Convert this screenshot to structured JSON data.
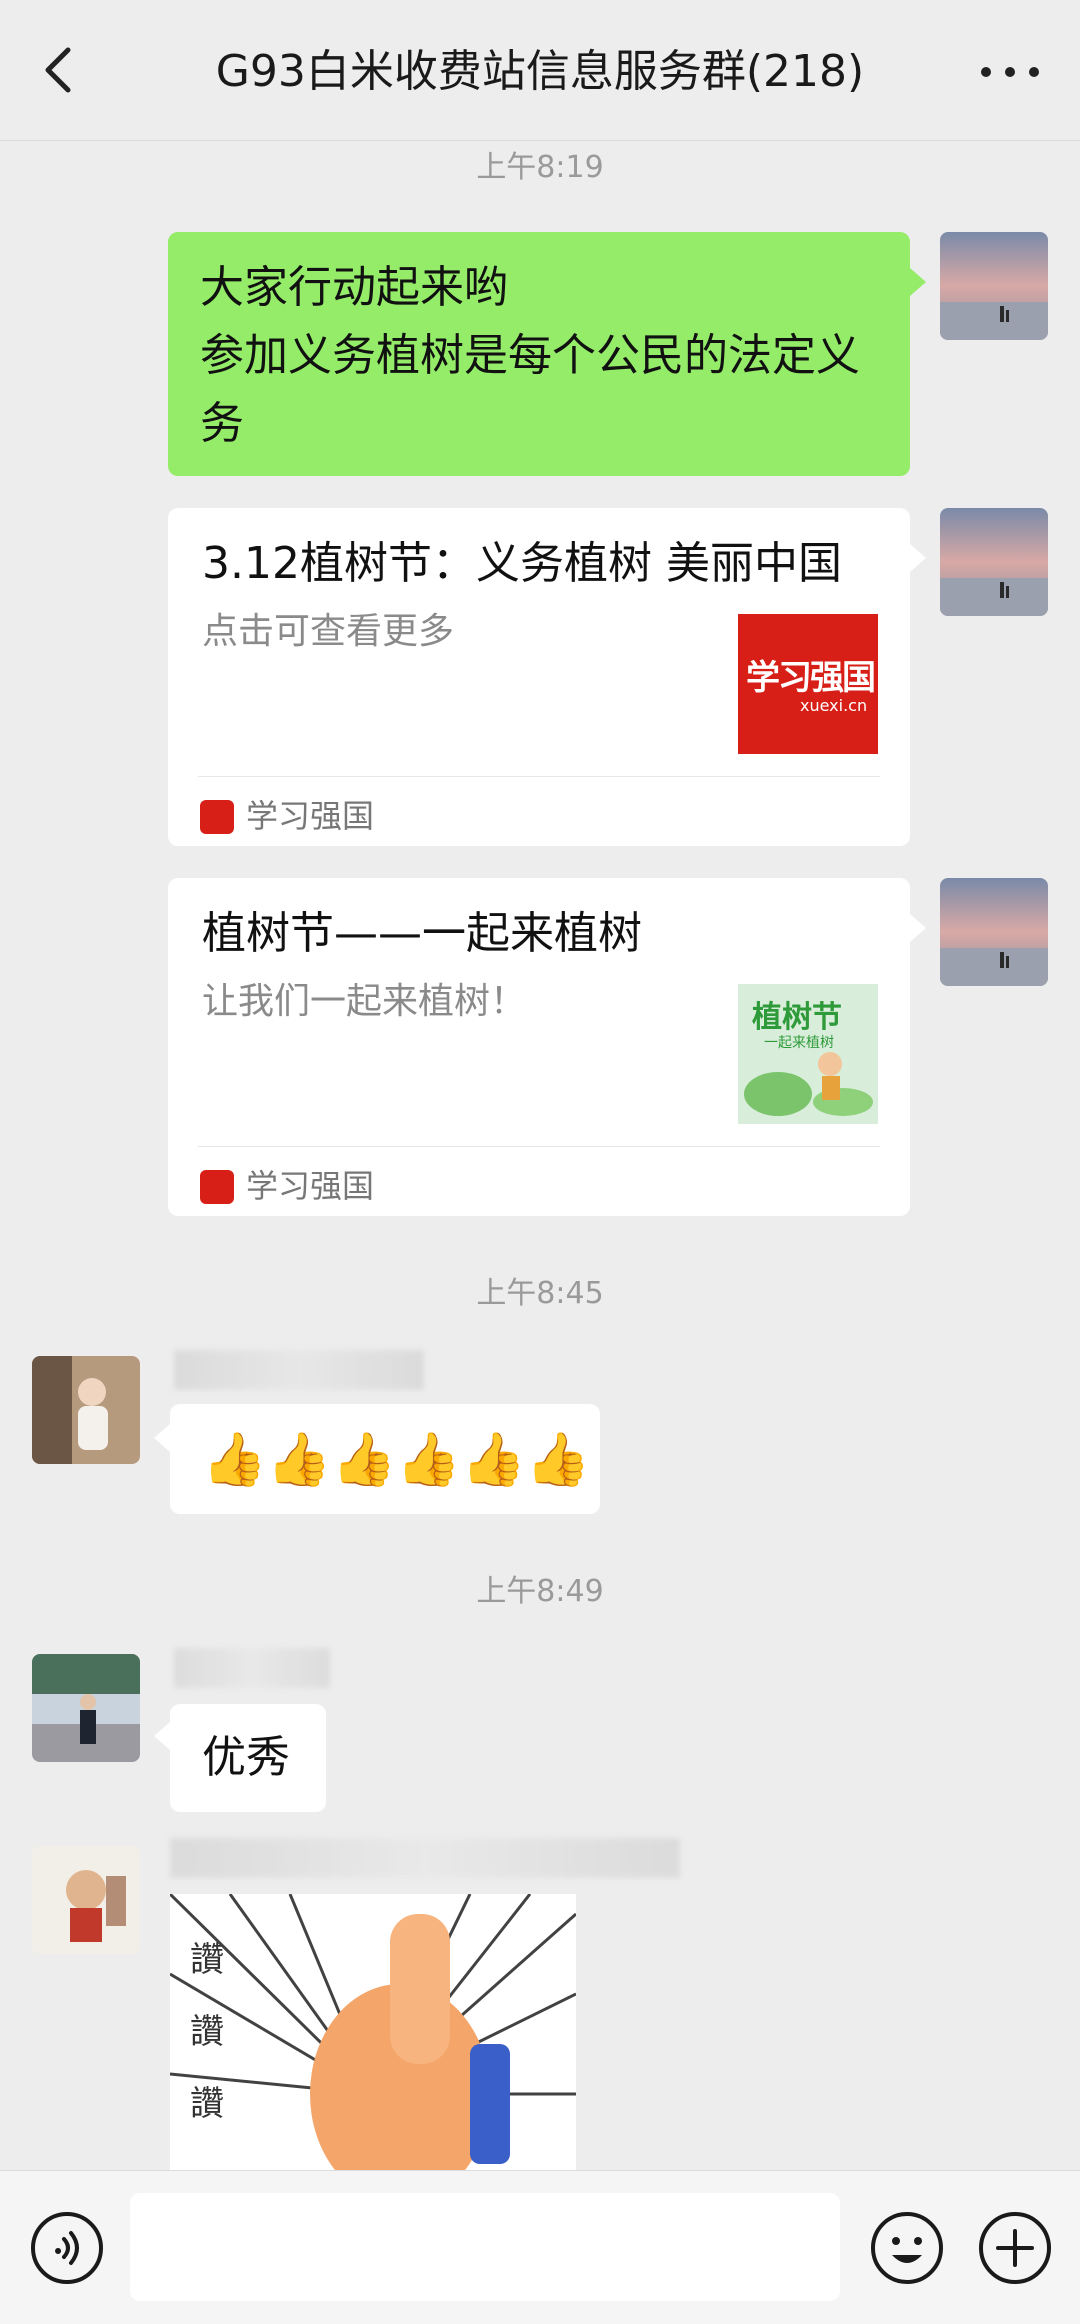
{
  "header": {
    "title": "G93白米收费站信息服务群(218)"
  },
  "messages": {
    "time1": "上午8:19",
    "text1_line1": "大家行动起来哟",
    "text1_line2": "参加义务植树是每个公民的法定义",
    "text1_line3": "务",
    "card1": {
      "title": "3.12植树节：义务植树 美丽中国",
      "desc": "点击可查看更多",
      "source": "学习强国",
      "thumb_text": "学习强国",
      "thumb_sub": "xuexi.cn"
    },
    "card2": {
      "title": "植树节——一起来植树",
      "desc": "让我们一起来植树！",
      "source": "学习强国",
      "thumb_text": "植树节",
      "thumb_sub": "一起来植树"
    },
    "time2": "上午8:45",
    "thumbs": "👍👍👍👍👍👍",
    "time3": "上午8:49",
    "reply_text": "优秀",
    "sticker_text": "讚 讚 讚"
  },
  "colors": {
    "sent_bubble": "#95ec69",
    "received_bubble": "#ffffff",
    "background": "#ededed",
    "xuexi_red": "#d71f18"
  },
  "icons": {
    "back": "chevron-left-icon",
    "more": "more-dots-icon",
    "voice": "voice-icon",
    "emoji": "emoji-icon",
    "plus": "plus-icon"
  }
}
